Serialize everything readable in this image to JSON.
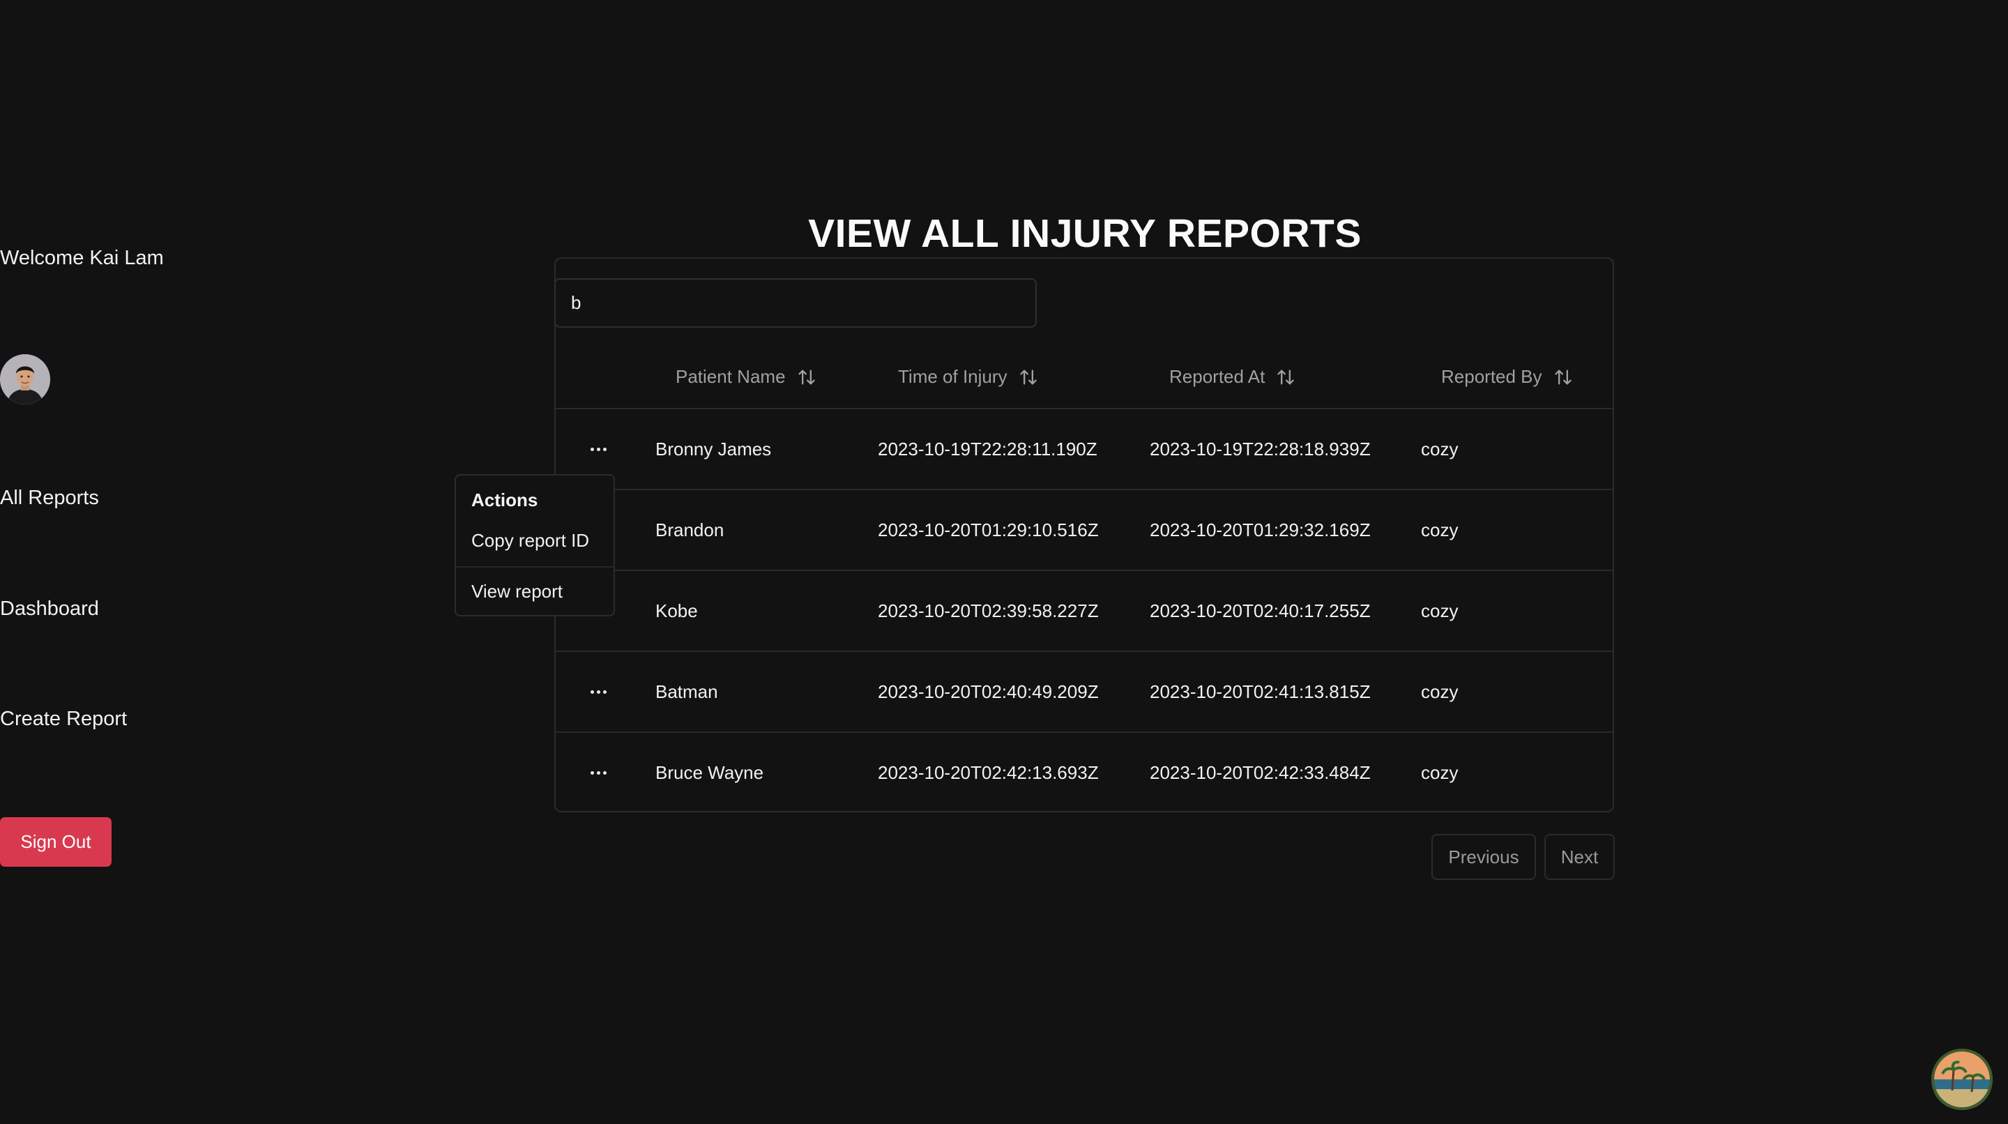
{
  "sidebar": {
    "welcome": "Welcome Kai Lam",
    "nav": {
      "all_reports": "All Reports",
      "dashboard": "Dashboard",
      "create_report": "Create Report"
    },
    "sign_out": "Sign Out"
  },
  "main": {
    "title": "VIEW ALL INJURY REPORTS",
    "search": {
      "value": "b",
      "placeholder": ""
    },
    "columns": [
      "Patient Name",
      "Time of Injury",
      "Reported At",
      "Reported By"
    ],
    "rows": [
      {
        "patient": "Bronny James",
        "time_of_injury": "2023-10-19T22:28:11.190Z",
        "reported_at": "2023-10-19T22:28:18.939Z",
        "reported_by": "cozy"
      },
      {
        "patient": "Brandon",
        "time_of_injury": "2023-10-20T01:29:10.516Z",
        "reported_at": "2023-10-20T01:29:32.169Z",
        "reported_by": "cozy"
      },
      {
        "patient": "Kobe",
        "time_of_injury": "2023-10-20T02:39:58.227Z",
        "reported_at": "2023-10-20T02:40:17.255Z",
        "reported_by": "cozy"
      },
      {
        "patient": "Batman",
        "time_of_injury": "2023-10-20T02:40:49.209Z",
        "reported_at": "2023-10-20T02:41:13.815Z",
        "reported_by": "cozy"
      },
      {
        "patient": "Bruce Wayne",
        "time_of_injury": "2023-10-20T02:42:13.693Z",
        "reported_at": "2023-10-20T02:42:33.484Z",
        "reported_by": "cozy"
      }
    ],
    "actions_menu": {
      "title": "Actions",
      "copy_id": "Copy report ID",
      "view_report": "View report"
    },
    "pagination": {
      "previous": "Previous",
      "next": "Next"
    }
  },
  "icons": {
    "row_menu": "ellipsis-icon",
    "sort": "arrow-up-down-icon"
  },
  "colors": {
    "background": "#121212",
    "sign_out_button": "#d9394f",
    "border": "#2b2b2b",
    "muted_text": "#a1a1a1"
  }
}
